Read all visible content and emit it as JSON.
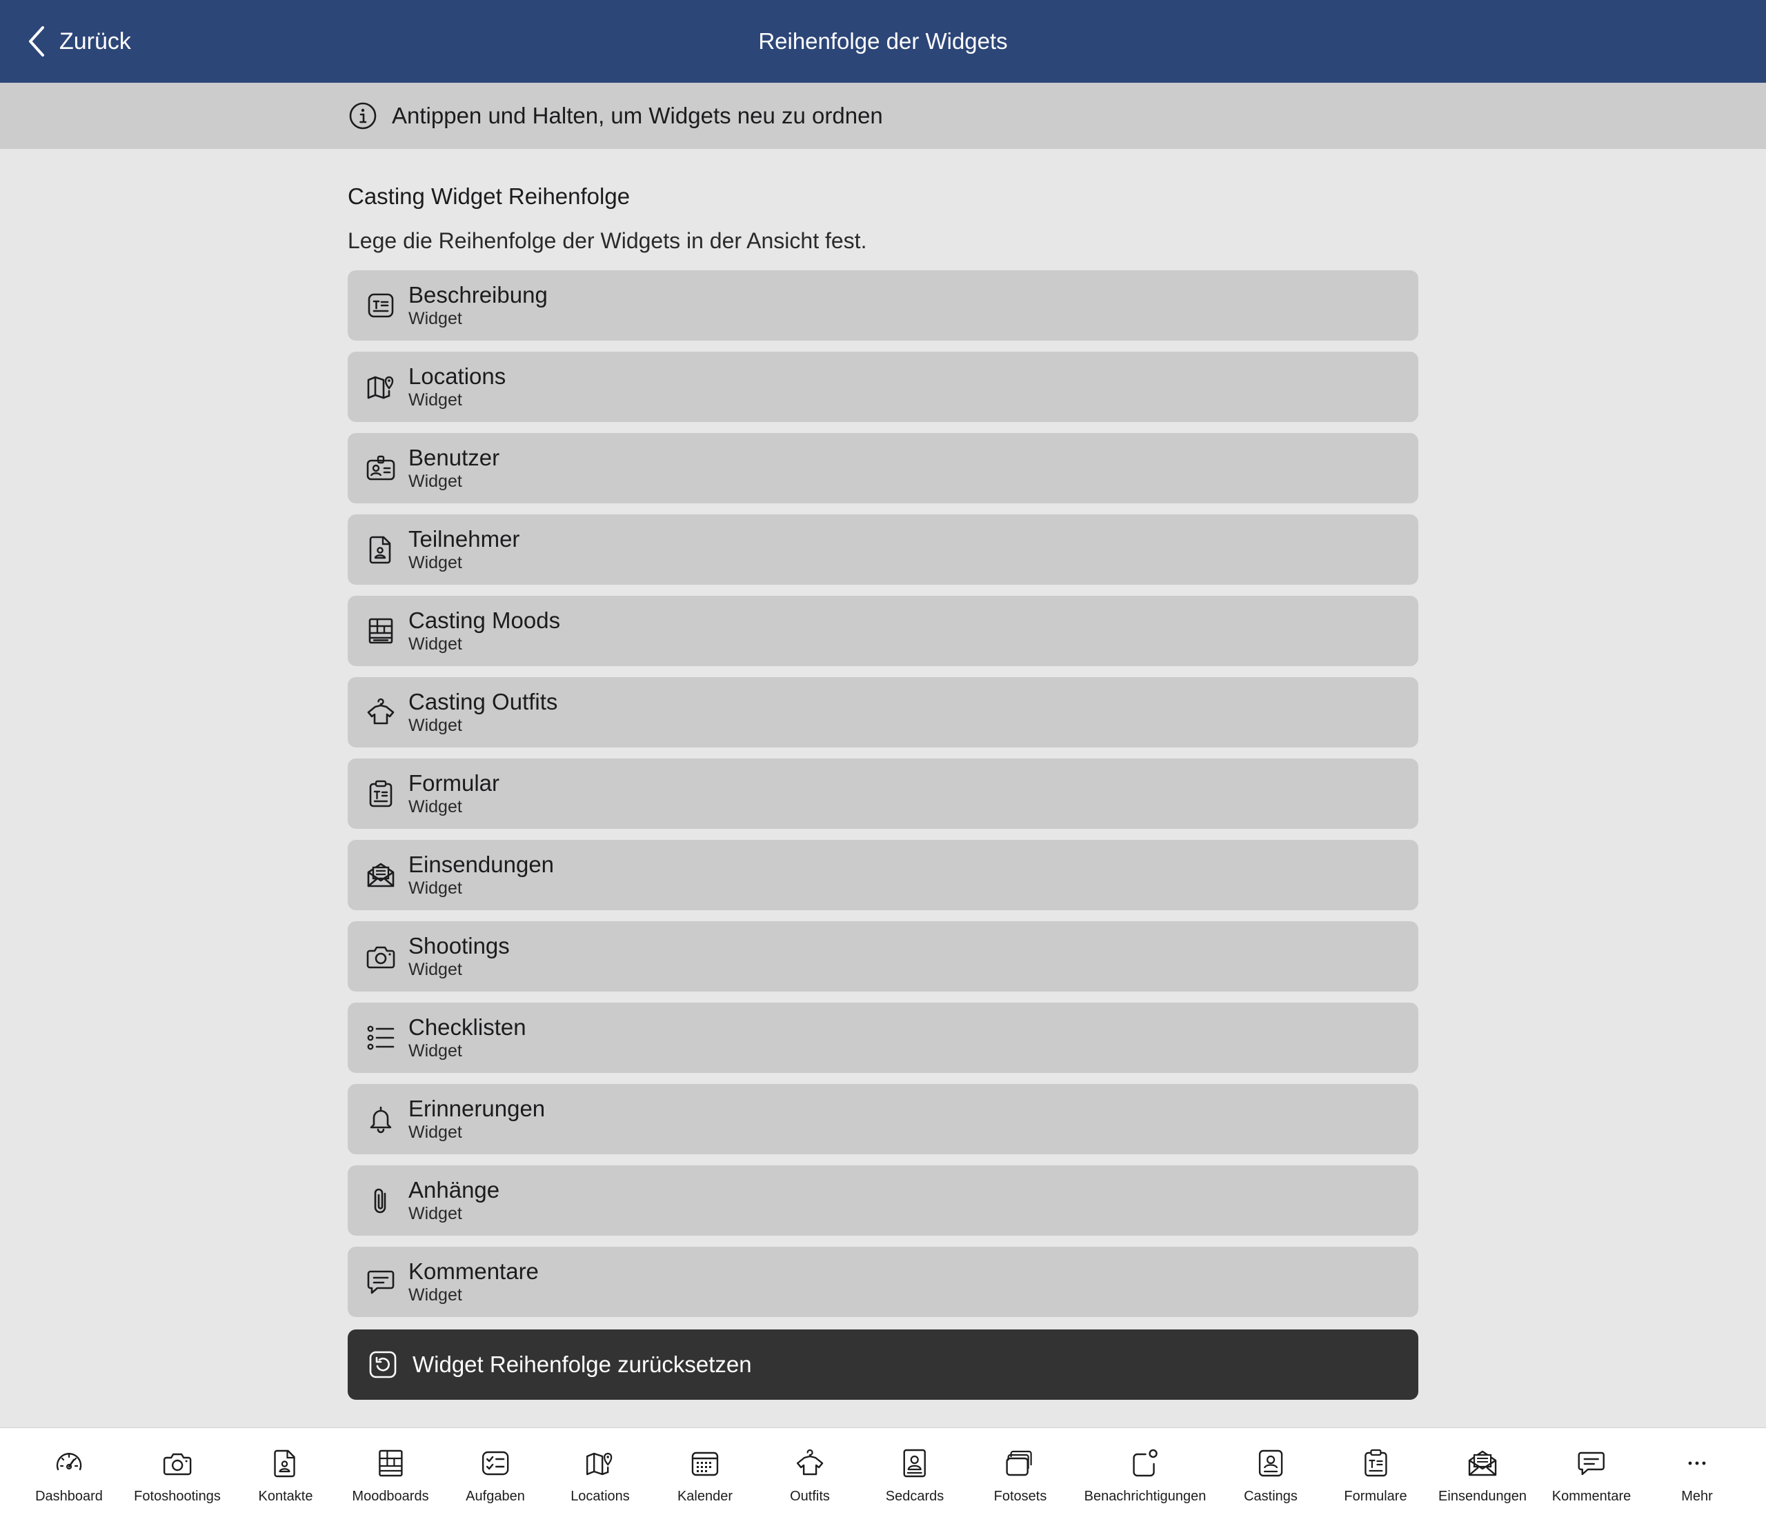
{
  "header": {
    "back_label": "Zurück",
    "title": "Reihenfolge der Widgets",
    "bar_color": "#2d4678"
  },
  "info_banner": {
    "icon": "info-icon",
    "text": "Antippen und Halten, um Widgets neu zu ordnen"
  },
  "section": {
    "title": "Casting Widget Reihenfolge",
    "description": "Lege die Reihenfolge der Widgets in der Ansicht fest."
  },
  "widgets": [
    {
      "title": "Beschreibung",
      "subtitle": "Widget",
      "icon": "description-icon"
    },
    {
      "title": "Locations",
      "subtitle": "Widget",
      "icon": "map-pin-icon"
    },
    {
      "title": "Benutzer",
      "subtitle": "Widget",
      "icon": "id-badge-icon"
    },
    {
      "title": "Teilnehmer",
      "subtitle": "Widget",
      "icon": "contact-file-icon"
    },
    {
      "title": "Casting Moods",
      "subtitle": "Widget",
      "icon": "moodboard-icon"
    },
    {
      "title": "Casting Outfits",
      "subtitle": "Widget",
      "icon": "shirt-icon"
    },
    {
      "title": "Formular",
      "subtitle": "Widget",
      "icon": "clipboard-icon"
    },
    {
      "title": "Einsendungen",
      "subtitle": "Widget",
      "icon": "envelope-icon"
    },
    {
      "title": "Shootings",
      "subtitle": "Widget",
      "icon": "camera-icon"
    },
    {
      "title": "Checklisten",
      "subtitle": "Widget",
      "icon": "checklist-icon"
    },
    {
      "title": "Erinnerungen",
      "subtitle": "Widget",
      "icon": "bell-icon"
    },
    {
      "title": "Anhänge",
      "subtitle": "Widget",
      "icon": "paperclip-icon"
    },
    {
      "title": "Kommentare",
      "subtitle": "Widget",
      "icon": "comment-icon"
    }
  ],
  "reset_button": {
    "label": "Widget Reihenfolge zurücksetzen",
    "icon": "reset-icon",
    "color": "#333333"
  },
  "tabbar": [
    {
      "label": "Dashboard",
      "icon": "gauge-icon"
    },
    {
      "label": "Fotoshootings",
      "icon": "camera-icon"
    },
    {
      "label": "Kontakte",
      "icon": "contact-file-icon"
    },
    {
      "label": "Moodboards",
      "icon": "moodboard-icon"
    },
    {
      "label": "Aufgaben",
      "icon": "tasks-icon"
    },
    {
      "label": "Locations",
      "icon": "map-pin-icon"
    },
    {
      "label": "Kalender",
      "icon": "calendar-icon"
    },
    {
      "label": "Outfits",
      "icon": "shirt-icon"
    },
    {
      "label": "Sedcards",
      "icon": "sedcard-icon"
    },
    {
      "label": "Fotosets",
      "icon": "photosets-icon"
    },
    {
      "label": "Benachrichtigungen",
      "icon": "notification-icon"
    },
    {
      "label": "Castings",
      "icon": "casting-icon"
    },
    {
      "label": "Formulare",
      "icon": "clipboard-icon"
    },
    {
      "label": "Einsendungen",
      "icon": "envelope-icon"
    },
    {
      "label": "Kommentare",
      "icon": "comment-icon"
    },
    {
      "label": "Mehr",
      "icon": "more-icon"
    }
  ]
}
